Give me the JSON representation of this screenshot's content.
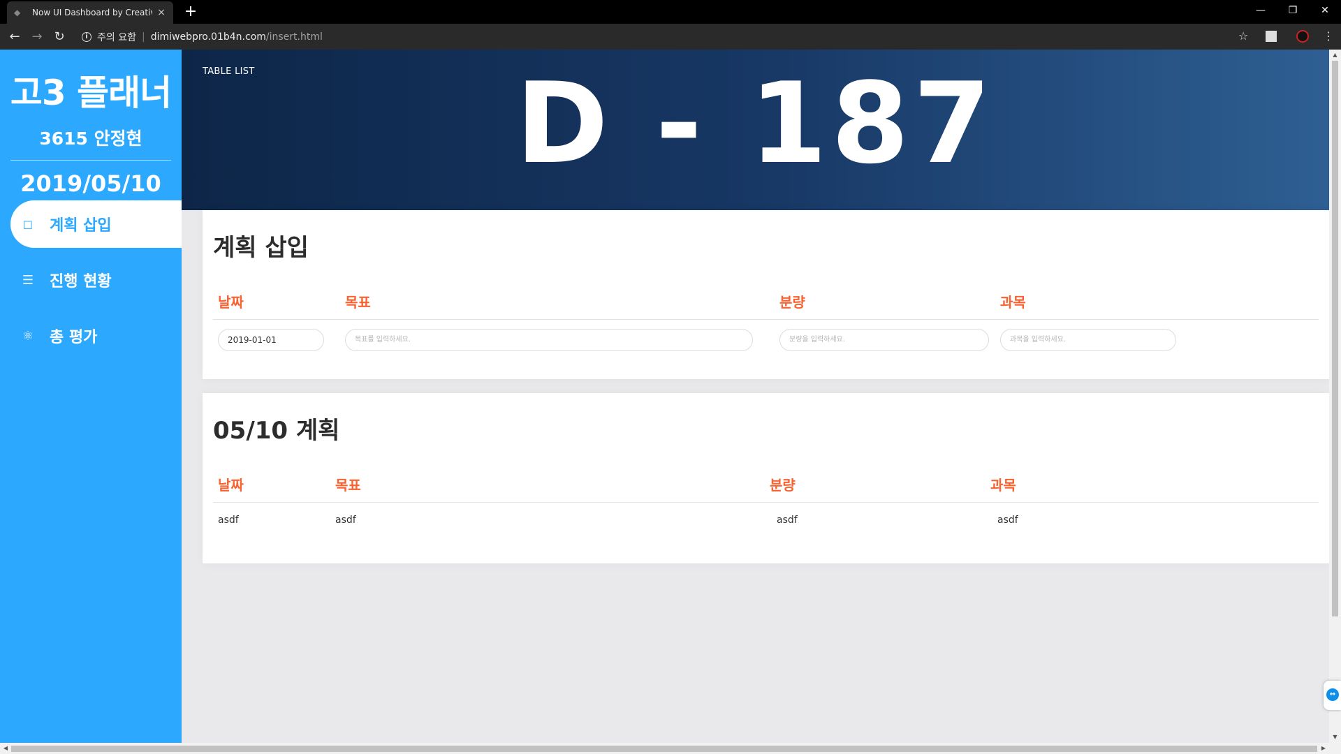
{
  "browser": {
    "tab_title": "Now UI Dashboard by Creative",
    "tab_close": "×",
    "new_tab": "+",
    "security_label": "주의 요함",
    "url_host": "dimiwebpro.01b4n.com",
    "url_path": "/insert.html"
  },
  "sidebar": {
    "brand": "고3 플래너",
    "student": "3615 안정현",
    "date": "2019/05/10",
    "items": [
      {
        "label": "계획 삽입",
        "icon": "cube-icon"
      },
      {
        "label": "진행 현황",
        "icon": "list-icon"
      },
      {
        "label": "총 평가",
        "icon": "atom-icon"
      }
    ]
  },
  "header": {
    "breadcrumb": "TABLE LIST",
    "dday": "D - 187"
  },
  "insert_card": {
    "title": "계획 삽입",
    "columns": [
      "날짜",
      "목표",
      "분량",
      "과목"
    ],
    "date_value": "2019-01-01",
    "goal_placeholder": "목표를 입력하세요.",
    "amount_placeholder": "분량을 입력하세요.",
    "subject_placeholder": "과목을 입력하세요."
  },
  "plan_card": {
    "title": "05/10  계획",
    "columns": [
      "날짜",
      "목표",
      "분량",
      "과목"
    ],
    "rows": [
      [
        "asdf",
        "asdf",
        "asdf",
        "asdf"
      ]
    ]
  },
  "colors": {
    "sidebar": "#2ca8ff",
    "header_dark": "#0d2648",
    "header_light": "#2e5f93",
    "column_heading": "#f96332"
  }
}
